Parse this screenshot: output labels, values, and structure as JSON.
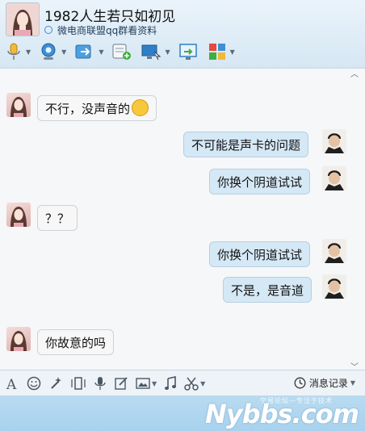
{
  "header": {
    "title": "1982人生若只如初见",
    "subtitle": "微电商联盟qq群看资料"
  },
  "toolbar": {
    "items": [
      {
        "icon": "microphone-icon",
        "has_dropdown": true
      },
      {
        "icon": "webcam-icon",
        "has_dropdown": true
      },
      {
        "icon": "file-transfer-icon",
        "has_dropdown": true
      },
      {
        "icon": "add-message-icon",
        "has_dropdown": false
      },
      {
        "icon": "remote-desktop-icon",
        "has_dropdown": true
      },
      {
        "icon": "screen-share-icon",
        "has_dropdown": false
      },
      {
        "icon": "apps-grid-icon",
        "has_dropdown": true
      }
    ]
  },
  "messages": [
    {
      "side": "left",
      "text": "不行，没声音的",
      "emoji": "dizzy-face-emoji"
    },
    {
      "side": "right",
      "text": "不可能是声卡的问题"
    },
    {
      "side": "right",
      "text": "你换个阴道试试"
    },
    {
      "side": "left",
      "text": "？？"
    },
    {
      "side": "right",
      "text": "你换个阴道试试"
    },
    {
      "side": "right",
      "text": "不是，是音道"
    },
    {
      "side": "left",
      "text": "你故意的吗"
    }
  ],
  "input_toolbar": {
    "items": [
      "font-icon",
      "emoji-icon",
      "magic-wand-icon",
      "shake-window-icon",
      "voice-message-icon",
      "edit-icon",
      "image-icon",
      "music-icon",
      "scissors-icon"
    ],
    "history_label": "消息记录"
  },
  "watermark": {
    "text": "Nybbs.com",
    "small_text": "宁易论坛—专注于技术"
  },
  "colors": {
    "header_bg": "#dfecf6",
    "chat_bg": "#f5f7f9",
    "bubble_left": "#f7f7f7",
    "bubble_right": "#d5e8f5",
    "bottom_bar": "#aed5ef"
  }
}
